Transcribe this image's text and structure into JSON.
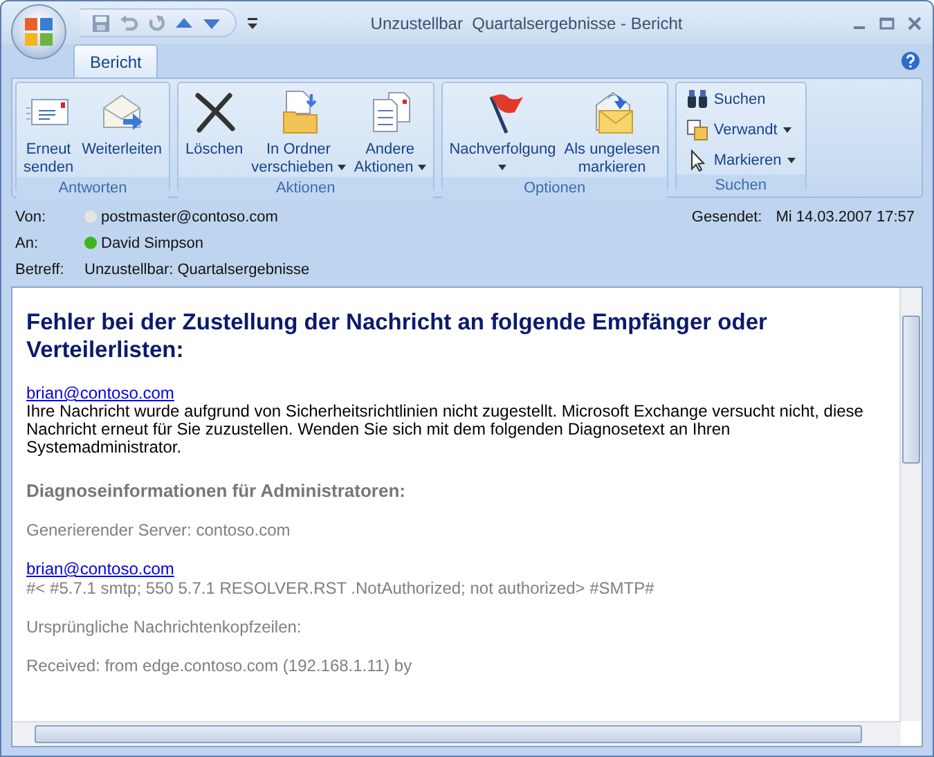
{
  "window": {
    "title": "Unzustellbar  Quartalsergebnisse - Bericht"
  },
  "tabs": [
    {
      "label": "Bericht",
      "selected": true
    }
  ],
  "ribbon": {
    "groups": [
      {
        "label": "Antworten",
        "buttons": [
          {
            "label": "Erneut\nsenden",
            "kind": "large",
            "dropdown": false
          },
          {
            "label": "Weiterleiten",
            "kind": "large",
            "dropdown": false
          }
        ]
      },
      {
        "label": "Aktionen",
        "buttons": [
          {
            "label": "Löschen",
            "kind": "large",
            "dropdown": false
          },
          {
            "label": "In Ordner\nverschieben",
            "kind": "large",
            "dropdown": true
          },
          {
            "label": "Andere\nAktionen",
            "kind": "large",
            "dropdown": true
          }
        ]
      },
      {
        "label": "Optionen",
        "buttons": [
          {
            "label": "Nachverfolgung",
            "kind": "large",
            "dropdown": true
          },
          {
            "label": "Als ungelesen\nmarkieren",
            "kind": "large",
            "dropdown": false
          }
        ]
      },
      {
        "label": "Suchen",
        "buttons": [
          {
            "label": "Suchen",
            "kind": "small",
            "dropdown": false
          },
          {
            "label": "Verwandt",
            "kind": "small",
            "dropdown": true
          },
          {
            "label": "Markieren",
            "kind": "small",
            "dropdown": true
          }
        ]
      }
    ]
  },
  "header": {
    "fields": [
      {
        "label": "Von:",
        "value": "postmaster@contoso.com",
        "color": "#e4e4e4"
      },
      {
        "label": "An:",
        "value": "David Simpson",
        "color": "#3cb521"
      },
      {
        "label": "Betreff:",
        "value": "Unzustellbar: Quartalsergebnisse"
      }
    ],
    "sent": {
      "label": "Gesendet:",
      "value": "Mi 14.03.2007 17:57"
    }
  },
  "body": {
    "paragraphs": [
      [
        {
          "kind": "heading",
          "text": "Fehler bei der Zustellung der Nachricht an folgende Empfänger oder Verteilerlisten:"
        }
      ],
      [
        {
          "kind": "link",
          "text": "brian@contoso.com"
        },
        {
          "kind": "text",
          "text": "Ihre Nachricht wurde aufgrund von Sicherheitsrichtlinien nicht zugestellt. Microsoft Exchange versucht nicht, diese Nachricht erneut für Sie zuzustellen. Wenden Sie sich mit dem folgenden Diagnosetext an Ihren Systemadministrator."
        }
      ],
      [
        {
          "kind": "subheading",
          "text": "Diagnoseinformationen für Administratoren:"
        }
      ],
      [
        {
          "kind": "note",
          "text": "Generierender Server: contoso.com"
        }
      ],
      [
        {
          "kind": "link",
          "text": "brian@contoso.com"
        },
        {
          "kind": "note",
          "text": "#< #5.7.1 smtp; 550 5.7.1 RESOLVER.RST .NotAuthorized; not authorized> #SMTP#"
        }
      ],
      [
        {
          "kind": "note",
          "text": "Ursprüngliche Nachrichtenkopfzeilen:"
        }
      ],
      [
        {
          "kind": "note",
          "text": "Received: from edge.contoso.com (192.168.1.11) by"
        }
      ]
    ]
  }
}
